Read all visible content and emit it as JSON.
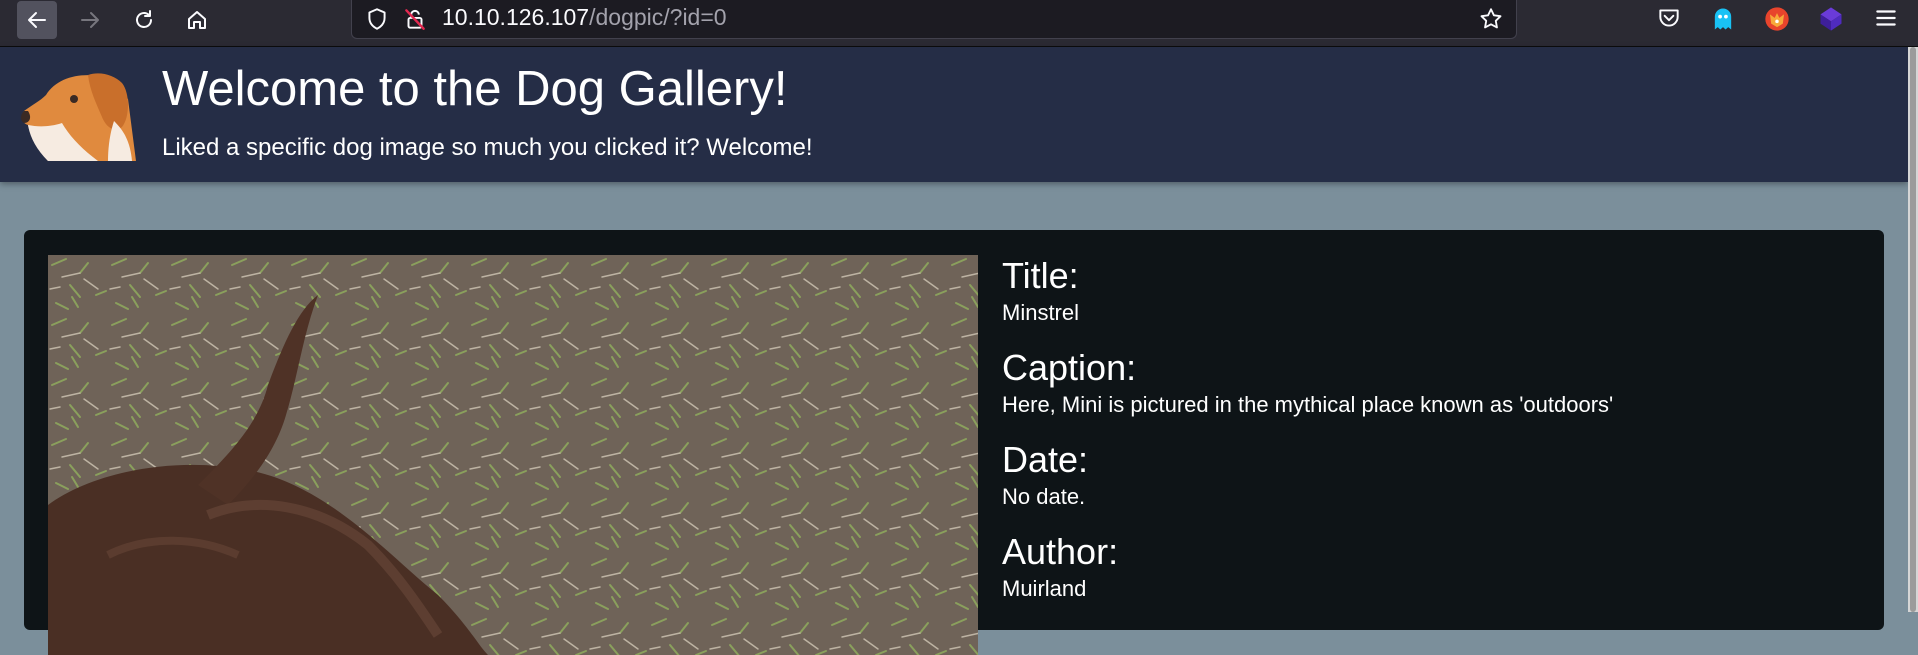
{
  "browser": {
    "url_host": "10.10.126.107",
    "url_path": "/dogpic/?id=0",
    "icons": [
      "back-arrow-icon",
      "forward-arrow-icon",
      "reload-icon",
      "home-icon",
      "shield-icon",
      "insecure-lock-icon",
      "bookmark-star-icon",
      "pocket-icon",
      "ghost-extension-icon",
      "fox-extension-icon",
      "cube-extension-icon",
      "hamburger-menu-icon"
    ]
  },
  "header": {
    "title": "Welcome to the Dog Gallery!",
    "subtitle": "Liked a specific dog image so much you clicked it? Welcome!",
    "logo_icon": "dog-head-icon"
  },
  "details": {
    "title_label": "Title:",
    "title_value": "Minstrel",
    "caption_label": "Caption:",
    "caption_value": "Here, Mini is pictured in the mythical place known as 'outdoors'",
    "date_label": "Date:",
    "date_value": "No date.",
    "author_label": "Author:",
    "author_value": "Muirland"
  },
  "colors": {
    "toolbar": "#2b2a33",
    "header": "#252d46",
    "page_background": "#7b8f9b",
    "card": "#0e1417"
  }
}
